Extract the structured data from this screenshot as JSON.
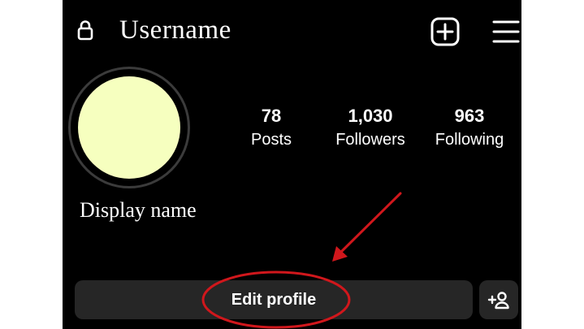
{
  "header": {
    "username": "Username",
    "lock_icon": "lock-icon",
    "add_icon": "plus-square-icon",
    "menu_icon": "hamburger-menu-icon"
  },
  "profile": {
    "display_name": "Display name",
    "avatar_color": "#f6ffbf"
  },
  "stats": [
    {
      "value": "78",
      "label": "Posts"
    },
    {
      "value": "1,030",
      "label": "Followers"
    },
    {
      "value": "963",
      "label": "Following"
    }
  ],
  "actions": {
    "edit_profile_label": "Edit profile",
    "add_person_icon": "add-person-icon"
  },
  "annotation": {
    "color": "#d0171c"
  }
}
